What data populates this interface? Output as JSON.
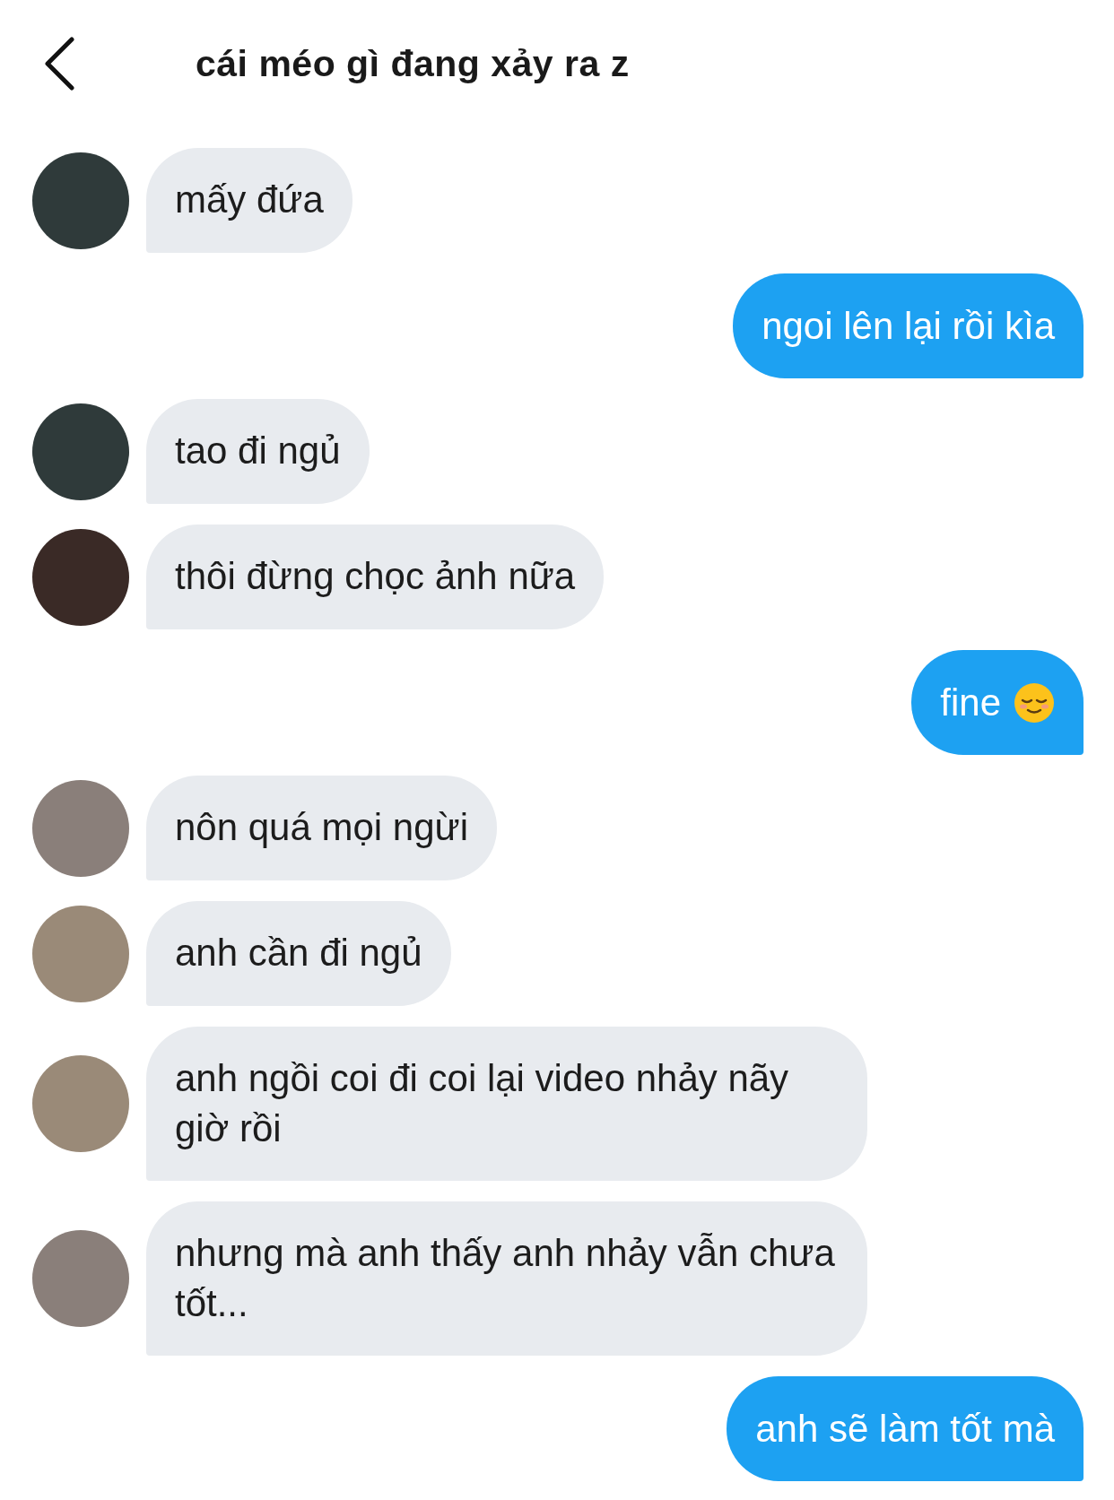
{
  "header": {
    "title": "cái méo gì đang xảy ra z"
  },
  "messages": [
    {
      "kind": "incoming",
      "text": "mấy đứa",
      "color": "#2f3a3a"
    },
    {
      "kind": "outgoing",
      "text": "ngoi lên lại rồi kìa"
    },
    {
      "kind": "incoming",
      "text": "tao đi ngủ",
      "color": "#2f3a3a"
    },
    {
      "kind": "incoming",
      "text": "thôi đừng chọc ảnh nữa",
      "color": "#3a2a26"
    },
    {
      "kind": "outgoing",
      "text": "fine",
      "emoji": true
    },
    {
      "kind": "incoming",
      "text": "nôn quá mọi ngừi",
      "color": "#8a7f7a"
    },
    {
      "kind": "incoming",
      "text": "anh cần đi ngủ",
      "color": "#9a8a78"
    },
    {
      "kind": "incoming",
      "text": "anh ngồi coi đi coi lại video nhảy nãy giờ rồi",
      "color": "#9a8a78"
    },
    {
      "kind": "incoming",
      "text": "nhưng mà anh thấy anh nhảy vẫn chưa tốt...",
      "color": "#8a7f7a"
    },
    {
      "kind": "outgoing",
      "text": "anh sẽ làm tốt mà"
    }
  ]
}
